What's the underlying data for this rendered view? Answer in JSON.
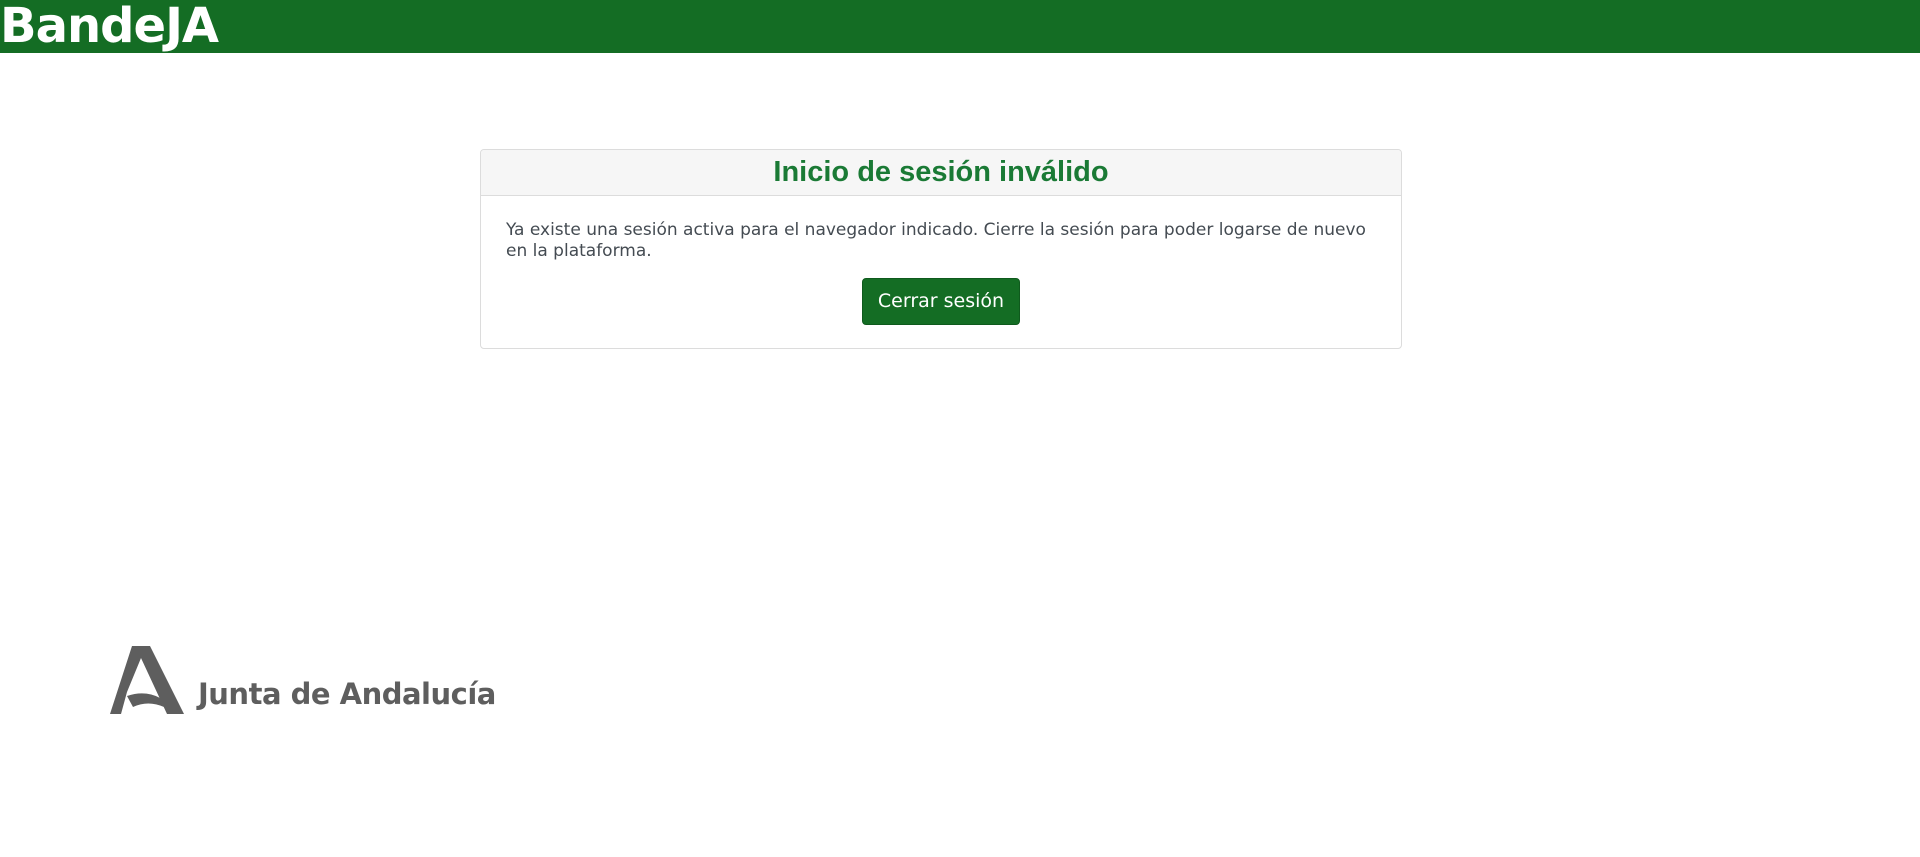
{
  "header": {
    "brand": "BandeJA",
    "background_color": "#146d24"
  },
  "dialog": {
    "title": "Inicio de sesión inválido",
    "message": "Ya existe una sesión activa para el navegador indicado. Cierre la sesión para poder logarse de nuevo en la plataforma.",
    "logout_button_label": "Cerrar sesión",
    "title_color": "#1a7a35",
    "button_color": "#146d24"
  },
  "footer": {
    "logo_icon": "junta-andalucia-logo-icon",
    "logo_text": "Junta de Andalucía",
    "logo_color": "#5e5e5e"
  }
}
